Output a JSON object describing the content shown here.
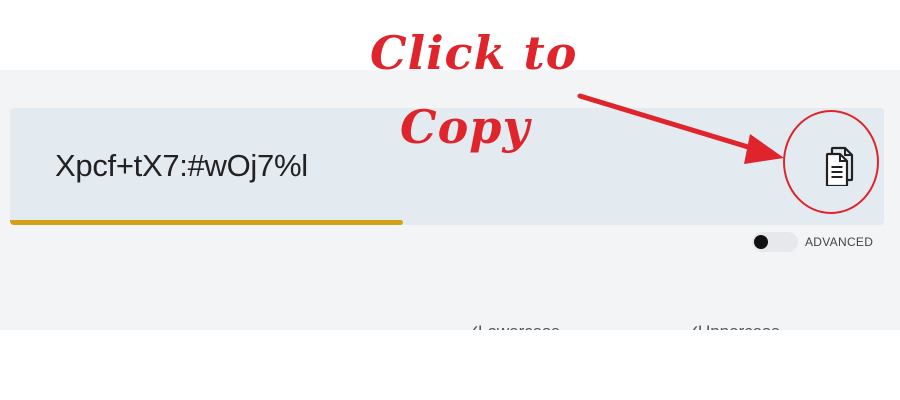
{
  "password": {
    "value": "Xpcf+tX7:#wOj7%l",
    "strength_fraction": 0.45,
    "strength_color": "#d4a017"
  },
  "copy": {
    "icon": "copy-icon"
  },
  "annotation": {
    "line1": "Click to",
    "line2": "Copy",
    "color": "#e0242b"
  },
  "advanced": {
    "label": "ADVANCED",
    "enabled": false
  },
  "options": [
    {
      "label": "Lowercase"
    },
    {
      "label": "Uppercase"
    }
  ]
}
